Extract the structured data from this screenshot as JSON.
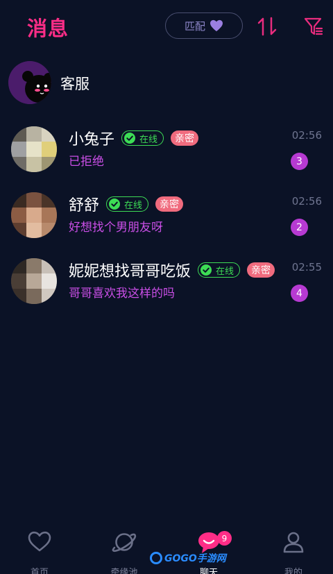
{
  "header": {
    "title": "消息",
    "match_label": "匹配",
    "sort_icon": "sort-updown-icon",
    "filter_icon": "filter-icon"
  },
  "service": {
    "label": "客服",
    "avatar_icon": "cat-avatar-icon"
  },
  "chats": [
    {
      "name": "小兔子",
      "online_label": "在线",
      "relation_label": "亲密",
      "preview": "已拒绝",
      "time": "02:56",
      "unread": "3"
    },
    {
      "name": "舒舒",
      "online_label": "在线",
      "relation_label": "亲密",
      "preview": "好想找个男朋友呀",
      "time": "02:56",
      "unread": "2"
    },
    {
      "name": "妮妮想找哥哥吃饭",
      "online_label": "在线",
      "relation_label": "亲密",
      "preview": "哥哥喜欢我这样的吗",
      "time": "02:55",
      "unread": "4"
    }
  ],
  "nav": {
    "items": [
      {
        "label": "首页",
        "icon": "heart-icon"
      },
      {
        "label": "牵缘池",
        "icon": "planet-icon"
      },
      {
        "label": "聊天",
        "icon": "chat-bubble-icon",
        "badge": "9"
      },
      {
        "label": "我的",
        "icon": "user-icon"
      }
    ],
    "active": "聊天"
  },
  "watermark": {
    "text": "GOGO手游网"
  },
  "colors": {
    "background": "#0b1226",
    "accent_pink": "#ff2d87",
    "preview_purple": "#c94ee6",
    "online_green": "#3ddc55",
    "intimate_pink": "#f06b7e",
    "unread_purple": "#b73ad2"
  }
}
